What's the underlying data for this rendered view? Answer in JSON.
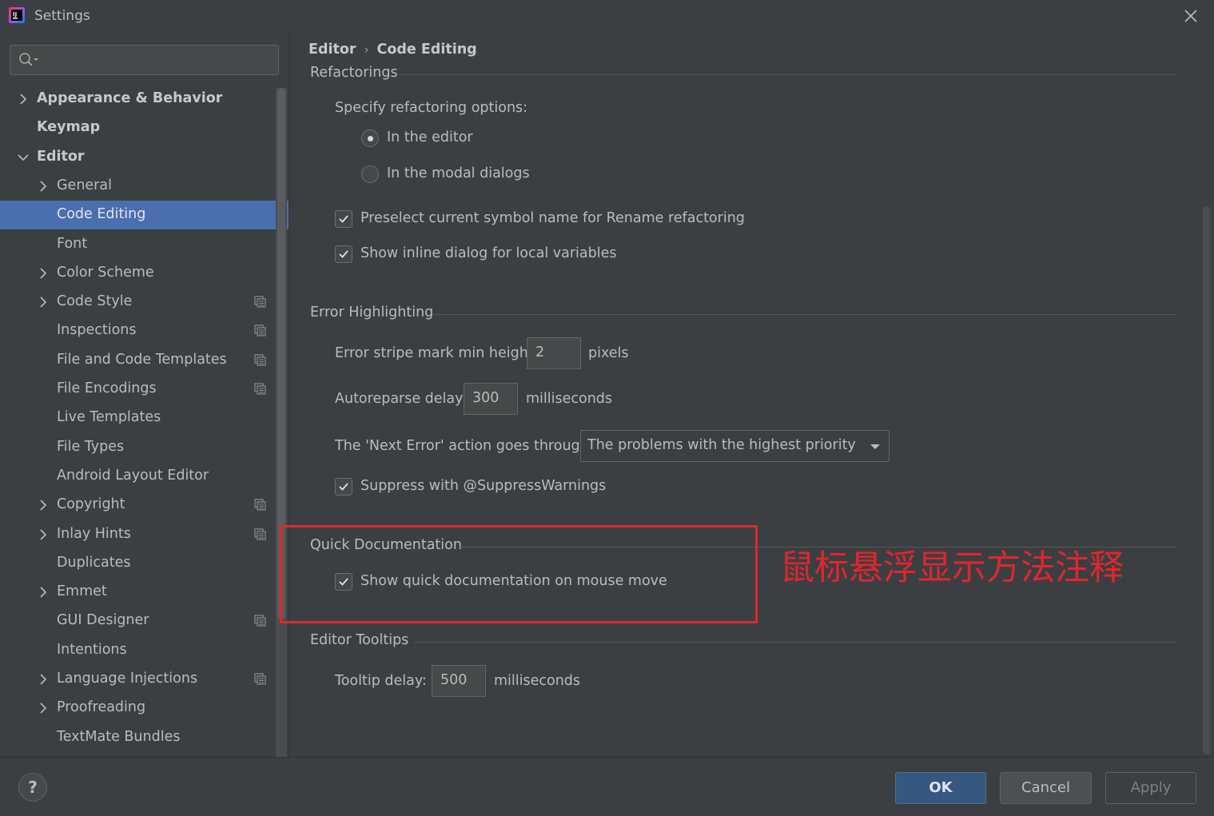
{
  "window": {
    "title": "Settings",
    "app_icon": "intellij-idea-icon",
    "close_icon": "close-icon"
  },
  "sidebar": {
    "search": {
      "value": "",
      "placeholder": "",
      "icon": "search-icon"
    },
    "items": [
      {
        "label": "Appearance & Behavior",
        "level": 0,
        "bold": true,
        "expandable": true,
        "expanded": false,
        "project_icon": false
      },
      {
        "label": "Keymap",
        "level": 0,
        "bold": true,
        "expandable": false,
        "project_icon": false
      },
      {
        "label": "Editor",
        "level": 0,
        "bold": true,
        "expandable": true,
        "expanded": true,
        "project_icon": false
      },
      {
        "label": "General",
        "level": 1,
        "expandable": true,
        "expanded": false,
        "project_icon": false
      },
      {
        "label": "Code Editing",
        "level": 1,
        "expandable": false,
        "selected": true,
        "project_icon": false
      },
      {
        "label": "Font",
        "level": 1,
        "expandable": false,
        "project_icon": false
      },
      {
        "label": "Color Scheme",
        "level": 1,
        "expandable": true,
        "expanded": false,
        "project_icon": false
      },
      {
        "label": "Code Style",
        "level": 1,
        "expandable": true,
        "expanded": false,
        "project_icon": true
      },
      {
        "label": "Inspections",
        "level": 1,
        "expandable": false,
        "project_icon": true
      },
      {
        "label": "File and Code Templates",
        "level": 1,
        "expandable": false,
        "project_icon": true
      },
      {
        "label": "File Encodings",
        "level": 1,
        "expandable": false,
        "project_icon": true
      },
      {
        "label": "Live Templates",
        "level": 1,
        "expandable": false,
        "project_icon": false
      },
      {
        "label": "File Types",
        "level": 1,
        "expandable": false,
        "project_icon": false
      },
      {
        "label": "Android Layout Editor",
        "level": 1,
        "expandable": false,
        "project_icon": false
      },
      {
        "label": "Copyright",
        "level": 1,
        "expandable": true,
        "expanded": false,
        "project_icon": true
      },
      {
        "label": "Inlay Hints",
        "level": 1,
        "expandable": true,
        "expanded": false,
        "project_icon": true
      },
      {
        "label": "Duplicates",
        "level": 1,
        "expandable": false,
        "project_icon": false
      },
      {
        "label": "Emmet",
        "level": 1,
        "expandable": true,
        "expanded": false,
        "project_icon": false
      },
      {
        "label": "GUI Designer",
        "level": 1,
        "expandable": false,
        "project_icon": true
      },
      {
        "label": "Intentions",
        "level": 1,
        "expandable": false,
        "project_icon": false
      },
      {
        "label": "Language Injections",
        "level": 1,
        "expandable": true,
        "expanded": false,
        "project_icon": true
      },
      {
        "label": "Proofreading",
        "level": 1,
        "expandable": true,
        "expanded": false,
        "project_icon": false
      },
      {
        "label": "TextMate Bundles",
        "level": 1,
        "expandable": false,
        "project_icon": false
      }
    ]
  },
  "breadcrumb": {
    "parent": "Editor",
    "separator": "›",
    "current": "Code Editing"
  },
  "refactorings": {
    "title": "Refactorings",
    "specify_label": "Specify refactoring options:",
    "radio_editor": {
      "label": "In the editor",
      "checked": true
    },
    "radio_modal": {
      "label": "In the modal dialogs",
      "checked": false
    },
    "preselect": {
      "label": "Preselect current symbol name for Rename refactoring",
      "checked": true
    },
    "inline_dialog": {
      "label": "Show inline dialog for local variables",
      "checked": true
    }
  },
  "error_highlighting": {
    "title": "Error Highlighting",
    "stripe_label": "Error stripe mark min height:",
    "stripe_value": "2",
    "stripe_unit": "pixels",
    "autoreparse_label": "Autoreparse delay:",
    "autoreparse_value": "300",
    "autoreparse_unit": "milliseconds",
    "next_error_label": "The 'Next Error' action goes through:",
    "next_error_value": "The problems with the highest priority",
    "suppress": {
      "label": "Suppress with @SuppressWarnings",
      "checked": true
    }
  },
  "quick_documentation": {
    "title": "Quick Documentation",
    "show_on_mouse": {
      "label": "Show quick documentation on mouse move",
      "checked": true
    }
  },
  "editor_tooltips": {
    "title": "Editor Tooltips",
    "delay_label": "Tooltip delay:",
    "delay_value": "500",
    "delay_unit": "milliseconds"
  },
  "annotation": {
    "text": "鼠标悬浮显示方法注释",
    "color": "#e0262e"
  },
  "footer": {
    "help": "?",
    "ok": "OK",
    "cancel": "Cancel",
    "apply": "Apply"
  },
  "colors": {
    "background": "#3c3f41",
    "selection": "#4b6eaf",
    "ok_button": "#365880",
    "text": "#bbbbbb"
  }
}
